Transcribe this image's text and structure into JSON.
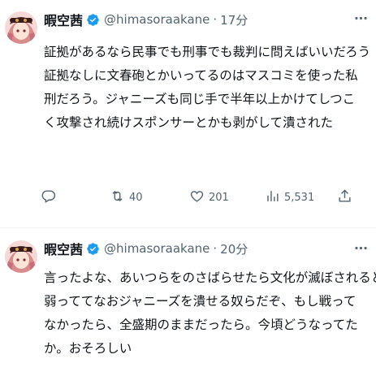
{
  "tweets": [
    {
      "author": {
        "display_name": "暇空茜",
        "handle": "@himasoraakane",
        "verified": true
      },
      "time": "17分",
      "lines": [
        "証拠があるなら民事でも刑事でも裁判に問えばいいだろう",
        "証拠なしに文春砲とかいってるのはマスコミを使った私刑だろう。ジャニーズも同じ手で半年以上かけてしつこく攻撃され続けスポンサーとかも剥がして潰された"
      ],
      "actions": {
        "replies": "",
        "retweets": "40",
        "likes": "201",
        "views": "5,531"
      }
    },
    {
      "author": {
        "display_name": "暇空茜",
        "handle": "@himasoraakane",
        "verified": true
      },
      "time": "20分",
      "lines": [
        "言ったよな、あいつらをのさばらせたら文化が滅ぼされると",
        "弱っててなおジャニーズを潰せる奴らだぞ、もし戦ってなかったら、全盛期のままだったら。今頃どうなってたか。おそろしい"
      ]
    }
  ],
  "colors": {
    "text": "#0f1419",
    "secondary": "#536471",
    "verified": "#1d9bf0",
    "divider": "#eff3f4"
  },
  "icons": [
    "avatar",
    "verified-badge-icon",
    "more-icon",
    "reply-icon",
    "retweet-icon",
    "like-icon",
    "views-icon",
    "share-icon"
  ]
}
